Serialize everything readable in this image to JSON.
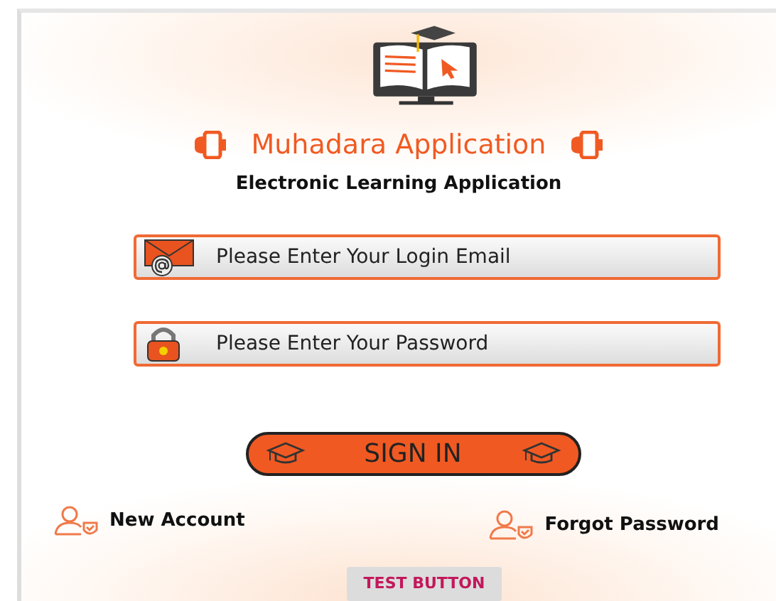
{
  "app": {
    "title": "Muhadara Application",
    "subtitle": "Electronic Learning Application"
  },
  "fields": [
    {
      "kind": "email",
      "placeholder": "Please Enter Your Login Email"
    },
    {
      "kind": "password",
      "placeholder": "Please Enter Your Password"
    }
  ],
  "sign_in": {
    "label": "SIGN IN"
  },
  "links": [
    {
      "label": "New Account"
    },
    {
      "label": "Forgot Password"
    }
  ],
  "test_button": {
    "label": "TEST BUTTON"
  }
}
